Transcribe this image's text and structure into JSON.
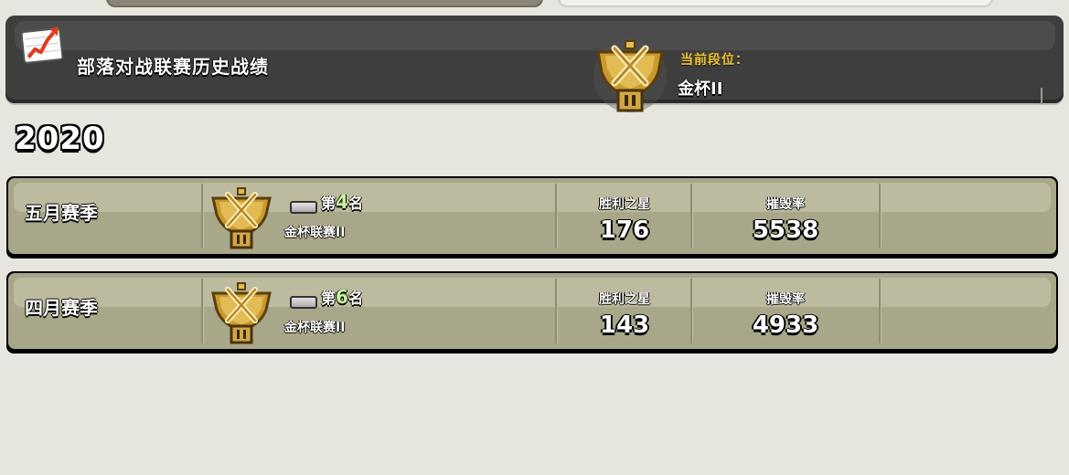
{
  "header": {
    "title": "部落对战联赛历史战绩",
    "rank_label": "当前段位：",
    "rank_value": "金杯II",
    "icon": "trend-graph-icon",
    "trophy_icon": "gold-trophy-icon"
  },
  "year": "2020",
  "stat_labels": {
    "stars": "胜利之星",
    "destruction": "摧毁率"
  },
  "seasons": [
    {
      "name": "五月赛季",
      "place_prefix": "第",
      "place_number": "4",
      "place_suffix": "名",
      "league": "金杯联赛II",
      "stars": "176",
      "destruction": "5538"
    },
    {
      "name": "四月赛季",
      "place_prefix": "第",
      "place_number": "6",
      "place_suffix": "名",
      "league": "金杯联赛II",
      "stars": "143",
      "destruction": "4933"
    }
  ],
  "colors": {
    "header_bg": "#3e3e3e",
    "row_bg": "#a9a78a",
    "rank_label": "#f6c632",
    "place_number": "#c8f3a0"
  }
}
